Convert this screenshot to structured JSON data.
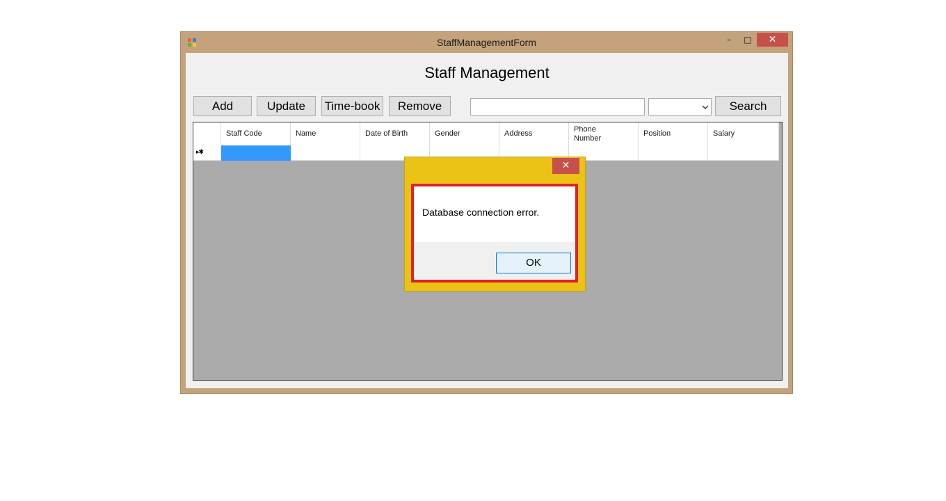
{
  "window": {
    "title": "StaffManagementForm",
    "minimize_glyph": "–",
    "maximize_glyph": "□",
    "close_glyph": "✕",
    "icon": "app-form-icon"
  },
  "form": {
    "heading": "Staff Management",
    "toolbar": {
      "add_label": "Add",
      "update_label": "Update",
      "timebook_label": "Time-book",
      "remove_label": "Remove",
      "search_label": "Search",
      "search_value": "",
      "filter_selected": ""
    },
    "grid": {
      "columns": [
        "Staff Code",
        "Name",
        "Date of Birth",
        "Gender",
        "Address",
        "Phone Number",
        "Position",
        "Salary"
      ],
      "new_row_marker": "▸✱"
    }
  },
  "dialog": {
    "message": "Database connection error.",
    "ok_label": "OK",
    "close_glyph": "✕"
  },
  "colors": {
    "window_frame": "#c4a27b",
    "dialog_frame": "#ebc216",
    "close_button": "#c7504a",
    "highlight_border": "#e32027",
    "selected_cell": "#3399ff"
  }
}
